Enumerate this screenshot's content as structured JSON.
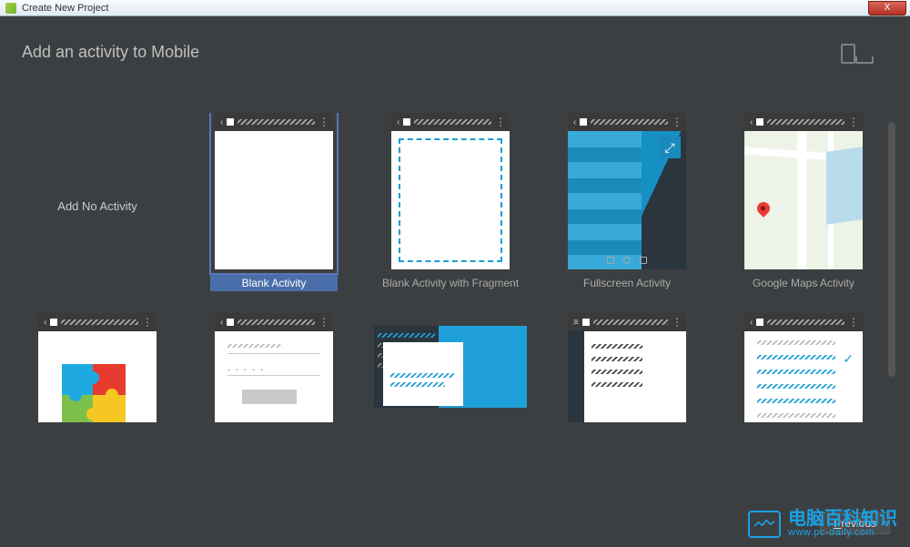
{
  "window": {
    "title": "Create New Project",
    "close": "X"
  },
  "header": {
    "title": "Add an activity to Mobile"
  },
  "activities": [
    {
      "id": "none",
      "label": "Add No Activity"
    },
    {
      "id": "blank",
      "label": "Blank Activity",
      "selected": true
    },
    {
      "id": "fragment",
      "label": "Blank Activity with Fragment"
    },
    {
      "id": "fullscreen",
      "label": "Fullscreen Activity"
    },
    {
      "id": "maps",
      "label": "Google Maps Activity"
    }
  ],
  "footer": {
    "previous": "Previous"
  },
  "watermark": {
    "cn": "电脑百科知识",
    "url": "www.pc-daily.com"
  }
}
